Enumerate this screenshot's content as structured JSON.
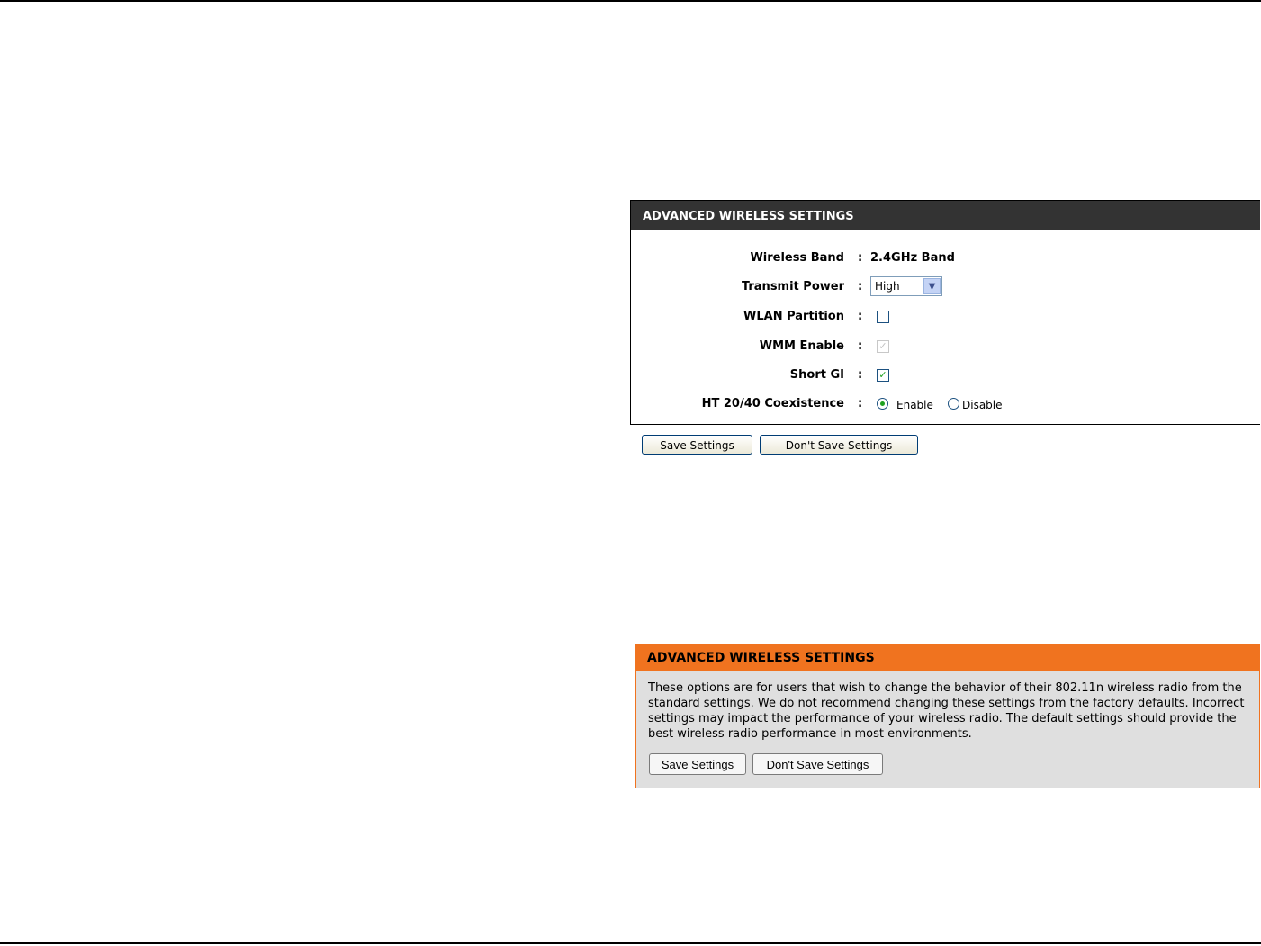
{
  "panel": {
    "title": "ADVANCED WIRELESS SETTINGS",
    "rows": {
      "wireless_band": {
        "label": "Wireless Band",
        "value": "2.4GHz Band"
      },
      "transmit_power": {
        "label": "Transmit Power",
        "value": "High"
      },
      "wlan_partition": {
        "label": "WLAN Partition",
        "checked": false
      },
      "wmm_enable": {
        "label": "WMM Enable",
        "checked": true,
        "disabled": true
      },
      "short_gi": {
        "label": "Short GI",
        "checked": true
      },
      "ht_coexistence": {
        "label": "HT 20/40 Coexistence",
        "option_enable": "Enable",
        "option_disable": "Disable",
        "selected": "Enable"
      }
    },
    "colon": ":",
    "save_label": "Save Settings",
    "dont_save_label": "Don't Save Settings"
  },
  "help": {
    "title": "ADVANCED WIRELESS SETTINGS",
    "text": "These options are for users that wish to change the behavior of their 802.11n wireless radio from the standard settings. We do not recommend changing these settings from the factory defaults. Incorrect settings may impact the performance of your wireless radio. The default settings should provide the best wireless radio performance in most environments.",
    "save_label": "Save Settings",
    "dont_save_label": "Don't Save Settings"
  },
  "colors": {
    "panel_header": "#333333",
    "help_header": "#f0731f",
    "help_bg": "#dfdfdf",
    "check": "#21a121"
  },
  "icons": {
    "checkmark": "✓",
    "dropdown": "chevron-down-icon"
  }
}
